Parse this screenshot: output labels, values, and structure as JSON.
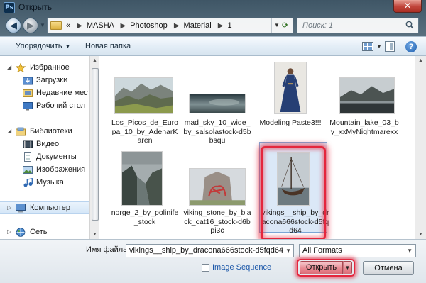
{
  "window": {
    "title": "Открыть",
    "app_icon_text": "Ps",
    "close_glyph": "✕"
  },
  "nav": {
    "back_glyph": "◀",
    "forward_glyph": "▶",
    "breadcrumb_lead": "«",
    "breadcrumb": [
      "MASHA",
      "Photoshop",
      "Material",
      "1"
    ],
    "breadcrumb_sep": "▶",
    "search_placeholder": "Поиск: 1"
  },
  "toolbar": {
    "organize_label": "Упорядочить",
    "new_folder_label": "Новая папка"
  },
  "sidebar": {
    "favorites": {
      "label": "Избранное",
      "items": [
        {
          "label": "Загрузки",
          "icon": "downloads-icon"
        },
        {
          "label": "Недавние места",
          "icon": "recent-places-icon"
        },
        {
          "label": "Рабочий стол",
          "icon": "desktop-icon"
        }
      ]
    },
    "libraries": {
      "label": "Библиотеки",
      "items": [
        {
          "label": "Видео",
          "icon": "video-icon"
        },
        {
          "label": "Документы",
          "icon": "documents-icon"
        },
        {
          "label": "Изображения",
          "icon": "pictures-icon"
        },
        {
          "label": "Музыка",
          "icon": "music-icon"
        }
      ]
    },
    "computer": {
      "label": "Компьютер"
    },
    "network": {
      "label": "Сеть"
    }
  },
  "files": [
    {
      "name": "Los_Picos_de_Europa_10_by_AdenarKaren",
      "thumb": "mountain-landscape"
    },
    {
      "name": "mad_sky_10_wide_by_salsolastock-d5bbsqu",
      "thumb": "stormy-sky"
    },
    {
      "name": "Modeling Paste3!!!",
      "thumb": "woman-in-blue-dress"
    },
    {
      "name": "Mountain_lake_03_by_xxMyNightmarexx",
      "thumb": "mountain-lake"
    },
    {
      "name": "norge_2_by_polinife_stock",
      "thumb": "fjord"
    },
    {
      "name": "viking_stone_by_black_cat16_stock-d6bpi3c",
      "thumb": "viking-stone"
    },
    {
      "name": "vikings__ship_by_dracona666stock-d5fqd64",
      "thumb": "viking-ship",
      "selected": true
    }
  ],
  "footer": {
    "filename_label": "Имя файла:",
    "filename_value": "vikings__ship_by_dracona666stock-d5fqd64",
    "format_value": "All Formats",
    "image_sequence_label": "Image Sequence",
    "open_label": "Открыть",
    "cancel_label": "Отмена"
  },
  "colors": {
    "highlight_red": "#e4263d",
    "selection_blue": "#bed6f0",
    "toolbar_bg": "#e4eef7"
  }
}
